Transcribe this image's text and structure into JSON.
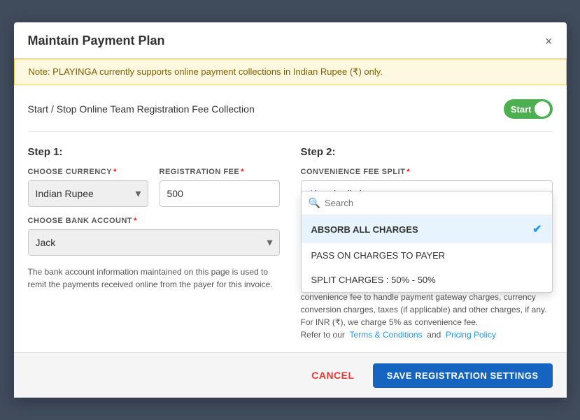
{
  "modal": {
    "title": "Maintain Payment Plan",
    "close_label": "×",
    "note": "Note: PLAYINGA currently supports online payment collections in Indian Rupee (₹) only.",
    "toggle": {
      "label": "Start / Stop Online Team Registration Fee Collection",
      "state_label": "Start"
    },
    "step1": {
      "heading": "Step 1:",
      "currency_label": "CHOOSE CURRENCY",
      "currency_value": "Indian Rupee",
      "reg_fee_label": "REGISTRATION FEE",
      "reg_fee_value": "500",
      "bank_label": "CHOOSE BANK ACCOUNT",
      "bank_value": "Jack",
      "bank_note": "The bank account information maintained on this page is used to remit the payments received online from the payer for this invoice."
    },
    "step2": {
      "heading": "Step 2:",
      "conv_label": "CONVENIENCE FEE SPLIT",
      "selected": "Absorb all charges",
      "search_placeholder": "Search",
      "options": [
        {
          "label": "ABSORB ALL CHARGES",
          "active": true
        },
        {
          "label": "PASS ON CHARGES TO PAYER",
          "active": false
        },
        {
          "label": "SPLIT CHARGES : 50% - 50%",
          "active": false
        }
      ],
      "fee_desc": "convenience fee to handle payment gateway charges, currency conversion charges, taxes (if applicable) and other charges, if any. For INR (₹), we charge 5% as convenience fee.",
      "terms_label": "Terms & Conditions",
      "pricing_label": "Pricing Policy",
      "refer_text": "Refer to our",
      "and_text": "and"
    }
  },
  "footer": {
    "cancel_label": "CANCEL",
    "save_label": "SAVE REGISTRATION SETTINGS"
  }
}
